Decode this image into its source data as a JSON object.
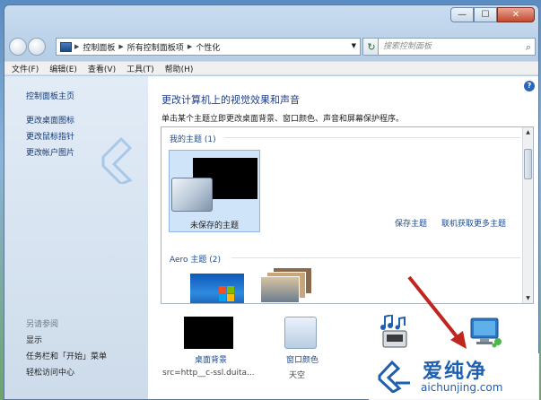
{
  "address": {
    "crumbs": [
      "控制面板",
      "所有控制面板项",
      "个性化"
    ]
  },
  "search": {
    "placeholder": "搜索控制面板"
  },
  "menu": [
    "文件(F)",
    "编辑(E)",
    "查看(V)",
    "工具(T)",
    "帮助(H)"
  ],
  "left_pane": {
    "links": [
      "控制面板主页",
      "更改桌面图标",
      "更改鼠标指针",
      "更改帐户图片"
    ],
    "see_also": "另请参阅",
    "see_also_links": [
      "显示",
      "任务栏和「开始」菜单",
      "轻松访问中心"
    ]
  },
  "main": {
    "title": "更改计算机上的视觉效果和声音",
    "subtitle": "单击某个主题立即更改桌面背景、窗口颜色、声音和屏幕保护程序。",
    "my_themes": "我的主题 (1)",
    "unsaved_theme": "未保存的主题",
    "save_theme": "保存主题",
    "get_more": "联机获取更多主题",
    "aero_themes": "Aero 主题 (2)",
    "desktop_bg": {
      "label": "桌面背景",
      "sub": "src=http__c-ssl.duita..."
    },
    "window_color": {
      "label": "窗口颜色",
      "sub": "天空"
    }
  },
  "watermark": {
    "name": "爱纯净",
    "url": "aichunjing.com"
  },
  "colors": {
    "accent": "#1e4b8f",
    "title": "#1e3f8c",
    "selected": "#cfe4f9"
  }
}
